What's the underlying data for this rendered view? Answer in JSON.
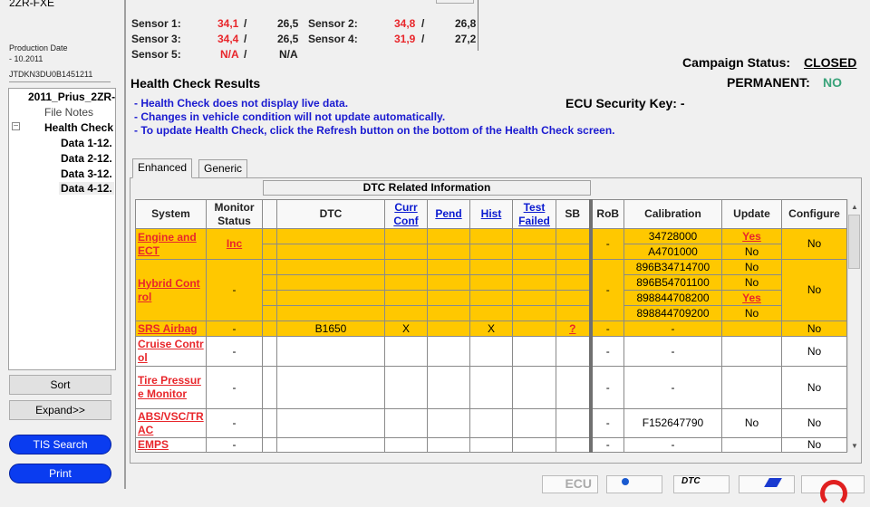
{
  "sidebar": {
    "model": "2ZR-FXE",
    "production_date_label": "Production Date",
    "production_date": " - 10.2011",
    "vin": "JTDKN3DU0B1451211",
    "tree": [
      "2011_Prius_2ZR-",
      "File Notes",
      "Health Check",
      "Data 1-12.",
      "Data 2-12.",
      "Data 3-12.",
      "Data 4-12."
    ],
    "sort": "Sort",
    "expand": "Expand>>",
    "tis_search": "TIS Search",
    "print": "Print"
  },
  "sensors": [
    {
      "label": "Sensor 1:",
      "v1": "34,1",
      "v2": "26,5"
    },
    {
      "label": "Sensor 2:",
      "v1": "34,8",
      "v2": "26,8"
    },
    {
      "label": "Sensor 3:",
      "v1": "34,4",
      "v2": "26,5"
    },
    {
      "label": "Sensor 4:",
      "v1": "31,9",
      "v2": "27,2"
    },
    {
      "label": "Sensor 5:",
      "v1": "N/A",
      "v2": "N/A"
    }
  ],
  "campaign": {
    "label": "Campaign Status:",
    "value": "CLOSED"
  },
  "permanent": {
    "label": "PERMANENT:",
    "value": "NO",
    "color": "#3aa37a"
  },
  "ecu_key": "ECU Security Key: -",
  "title": "Health Check Results",
  "notes": [
    "- Health Check does not display live data.",
    "- Changes in vehicle condition will not update automatically.",
    "- To update Health Check, click the Refresh button on the bottom of the Health Check screen."
  ],
  "tabs": [
    "Enhanced",
    "Generic"
  ],
  "dtc_group": "DTC Related Information",
  "columns": [
    "System",
    "Monitor Status",
    "",
    "DTC",
    "Curr Conf",
    "Pend",
    "Hist",
    "Test Failed",
    "SB",
    "RoB",
    "Calibration",
    "Update",
    "Configure"
  ],
  "rows": [
    {
      "system": "Engine and ECT",
      "monitor": "Inc",
      "highlight": true,
      "rob": "-",
      "configure": "No",
      "sub": [
        {
          "dtc": "",
          "curr": "",
          "pend": "",
          "hist": "",
          "test": "",
          "sb": "",
          "cal": "34728000",
          "update": "Yes"
        },
        {
          "dtc": "",
          "curr": "",
          "pend": "",
          "hist": "",
          "test": "",
          "sb": "",
          "cal": "A4701000",
          "update": "No"
        }
      ]
    },
    {
      "system": "Hybrid Control",
      "monitor": "-",
      "highlight": true,
      "rob": "-",
      "configure": "No",
      "sub": [
        {
          "dtc": "",
          "curr": "",
          "pend": "",
          "hist": "",
          "test": "",
          "sb": "",
          "cal": "896B34714700",
          "update": "No"
        },
        {
          "dtc": "",
          "curr": "",
          "pend": "",
          "hist": "",
          "test": "",
          "sb": "",
          "cal": "896B54701100",
          "update": "No"
        },
        {
          "dtc": "",
          "curr": "",
          "pend": "",
          "hist": "",
          "test": "",
          "sb": "",
          "cal": "898844708200",
          "update": "Yes"
        },
        {
          "dtc": "",
          "curr": "",
          "pend": "",
          "hist": "",
          "test": "",
          "sb": "",
          "cal": "898844709200",
          "update": "No"
        }
      ]
    },
    {
      "system": "SRS Airbag",
      "monitor": "-",
      "highlight": true,
      "rob": "-",
      "configure": "No",
      "sub": [
        {
          "dtc": "B1650",
          "curr": "X",
          "pend": "",
          "hist": "X",
          "test": "",
          "sb": "?",
          "cal": "-",
          "update": ""
        }
      ]
    },
    {
      "system": "Cruise Control",
      "monitor": "-",
      "highlight": false,
      "rob": "-",
      "configure": "No",
      "sub": [
        {
          "dtc": "",
          "curr": "",
          "pend": "",
          "hist": "",
          "test": "",
          "sb": "",
          "cal": "-",
          "update": ""
        }
      ]
    },
    {
      "system": "Tire Pressure Monitor",
      "monitor": "-",
      "highlight": false,
      "rob": "-",
      "configure": "No",
      "sub": [
        {
          "dtc": "",
          "curr": "",
          "pend": "",
          "hist": "",
          "test": "",
          "sb": "",
          "cal": "-",
          "update": ""
        }
      ]
    },
    {
      "system": "ABS/VSC/TRAC",
      "monitor": "-",
      "highlight": false,
      "rob": "-",
      "configure": "No",
      "sub": [
        {
          "dtc": "",
          "curr": "",
          "pend": "",
          "hist": "",
          "test": "",
          "sb": "",
          "cal": "F152647790",
          "update": "No"
        }
      ]
    },
    {
      "system": "EMPS",
      "monitor": "-",
      "highlight": false,
      "rob": "-",
      "configure": "No",
      "sub": [
        {
          "dtc": "",
          "curr": "",
          "pend": "",
          "hist": "",
          "test": "",
          "sb": "",
          "cal": "-",
          "update": ""
        }
      ]
    }
  ],
  "toolbar": {
    "ecu": "ECU",
    "dtc": "DTC"
  }
}
